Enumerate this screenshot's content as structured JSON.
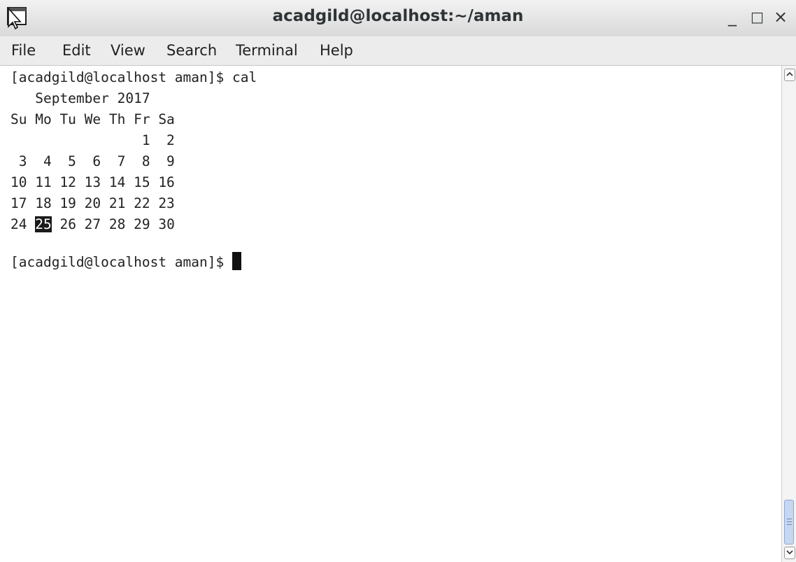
{
  "window": {
    "title": "acadgild@localhost:~/aman",
    "controls": {
      "minimize": "_",
      "maximize": "□",
      "close": "×"
    },
    "icon": "terminal-window-icon"
  },
  "menubar": {
    "items": [
      "File",
      "Edit",
      "View",
      "Search",
      "Terminal",
      "Help"
    ]
  },
  "terminal": {
    "command_line": "[acadgild@localhost aman]$ cal",
    "calendar": {
      "header": "   September 2017",
      "weekdays": "Su Mo Tu We Th Fr Sa",
      "week1": "                1  2",
      "week2": " 3  4  5  6  7  8  9",
      "week3": "10 11 12 13 14 15 16",
      "week4": "17 18 19 20 21 22 23",
      "week5_before": "24 ",
      "week5_today": "25",
      "week5_after": " 26 27 28 29 30"
    },
    "prompt": "[acadgild@localhost aman]$ "
  },
  "scrollbar": {
    "position": 1.0
  }
}
